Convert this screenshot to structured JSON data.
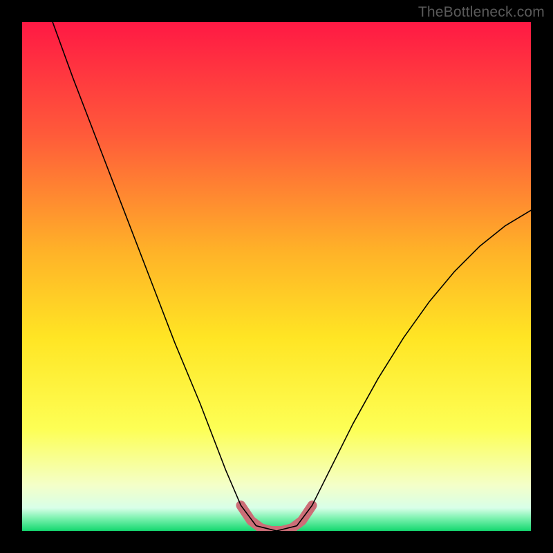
{
  "watermark": "TheBottleneck.com",
  "chart_data": {
    "type": "line",
    "title": "",
    "xlabel": "",
    "ylabel": "",
    "xlim": [
      0,
      1
    ],
    "ylim": [
      0,
      1
    ],
    "grid": false,
    "background_gradient": {
      "top": "#ff1944",
      "mid_upper": "#ff8c2a",
      "mid": "#ffe524",
      "mid_lower": "#fdff55",
      "near_bottom": "#f4ffd0",
      "bottom": "#1be07a"
    },
    "series": [
      {
        "name": "main-curve",
        "x": [
          0.06,
          0.1,
          0.15,
          0.2,
          0.25,
          0.3,
          0.35,
          0.4,
          0.43,
          0.46,
          0.5,
          0.54,
          0.57,
          0.6,
          0.65,
          0.7,
          0.75,
          0.8,
          0.85,
          0.9,
          0.95,
          1.0
        ],
        "y": [
          1.0,
          0.89,
          0.76,
          0.63,
          0.5,
          0.37,
          0.25,
          0.12,
          0.05,
          0.01,
          0.0,
          0.01,
          0.05,
          0.11,
          0.21,
          0.3,
          0.38,
          0.45,
          0.51,
          0.56,
          0.6,
          0.63
        ],
        "stroke": "#000000",
        "stroke_width": 1.6
      },
      {
        "name": "highlight-valley",
        "x": [
          0.43,
          0.45,
          0.47,
          0.49,
          0.51,
          0.53,
          0.55,
          0.57
        ],
        "y": [
          0.05,
          0.02,
          0.005,
          0.0,
          0.0,
          0.005,
          0.02,
          0.05
        ],
        "stroke": "#cc6e77",
        "stroke_width": 14,
        "linecap": "round"
      }
    ]
  }
}
